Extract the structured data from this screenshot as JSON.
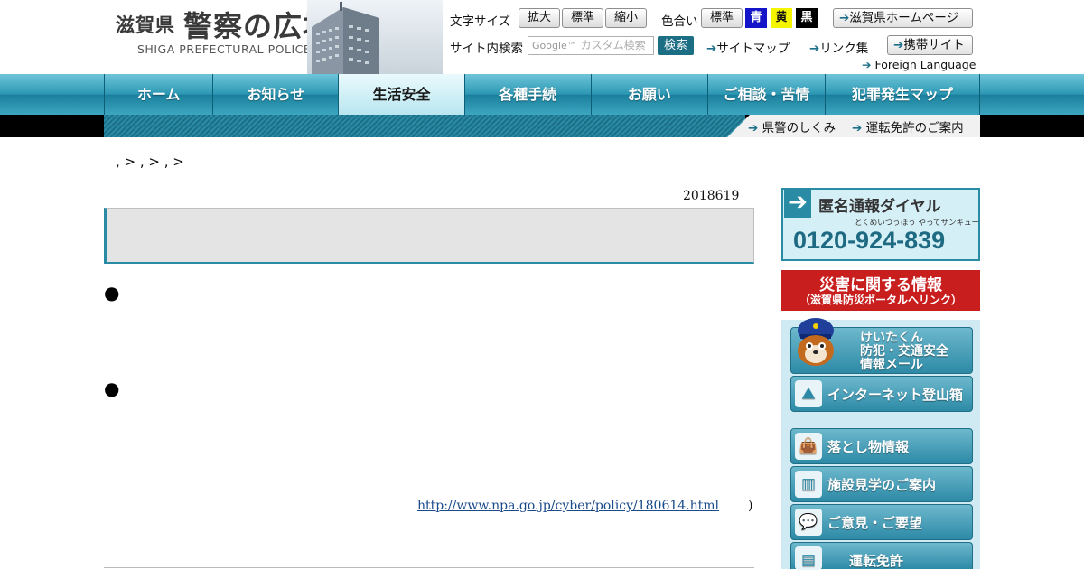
{
  "header": {
    "logo_pref": "滋賀県",
    "logo_main": "警察の広場",
    "logo_en": "SHIGA PREFECTURAL POLICE",
    "font_size_label": "文字サイズ",
    "font_size_buttons": [
      "拡大",
      "標準",
      "縮小"
    ],
    "color_label": "色合い",
    "color_buttons": [
      {
        "label": "標準",
        "bg": "#ffffff",
        "fg": "#111111"
      },
      {
        "label": "青",
        "bg": "#1414c8",
        "fg": "#ffffff"
      },
      {
        "label": "黄",
        "bg": "#f5f500",
        "fg": "#111111"
      },
      {
        "label": "黒",
        "bg": "#000000",
        "fg": "#ffffff"
      }
    ],
    "pref_home_link": "滋賀県ホームページ",
    "search_label": "サイト内検索",
    "search_placeholder": "カスタム検索",
    "search_brand": "Google™",
    "search_button": "検索",
    "sitemap_link": "サイトマップ",
    "links_link": "リンク集",
    "mobile_link": "携帯サイト",
    "foreign_link": "Foreign Language"
  },
  "nav": {
    "items": [
      "ホーム",
      "お知らせ",
      "生活安全",
      "各種手続",
      "お願い",
      "ご相談・苦情",
      "犯罪発生マップ"
    ],
    "active_index": 2
  },
  "subnav": {
    "links": [
      "県警のしくみ",
      "運転免許のご案内"
    ]
  },
  "content": {
    "breadcrumb": ", > , > , >",
    "date": "2018619",
    "bullets": [
      "●",
      "●"
    ],
    "external_link": "http://www.npa.go.jp/cyber/policy/180614.html",
    "paren": ")"
  },
  "sidebar": {
    "dial_title": "匿名通報ダイヤル",
    "dial_kana": "とくめいつうほう やってサンキュー",
    "dial_number": "0120-924-839",
    "disaster_title": "災害に関する情報",
    "disaster_sub": "（滋賀県防災ポータルへリンク）",
    "keitaku_lines": [
      "けいたくん",
      "防犯・交通安全",
      "情報メール"
    ],
    "buttons": [
      "インターネット登山箱",
      "落とし物情報",
      "施設見学のご案内",
      "ご意見・ご要望",
      "運転免許"
    ]
  },
  "colors": {
    "accent": "#2a8ba5",
    "nav_dark": "#1a7f9c",
    "disaster_red": "#c81e1e"
  },
  "icons": [
    "arrow-right-icon",
    "mountain-icon",
    "bag-icon",
    "building-icon",
    "speech-bubble-icon",
    "license-icon"
  ]
}
